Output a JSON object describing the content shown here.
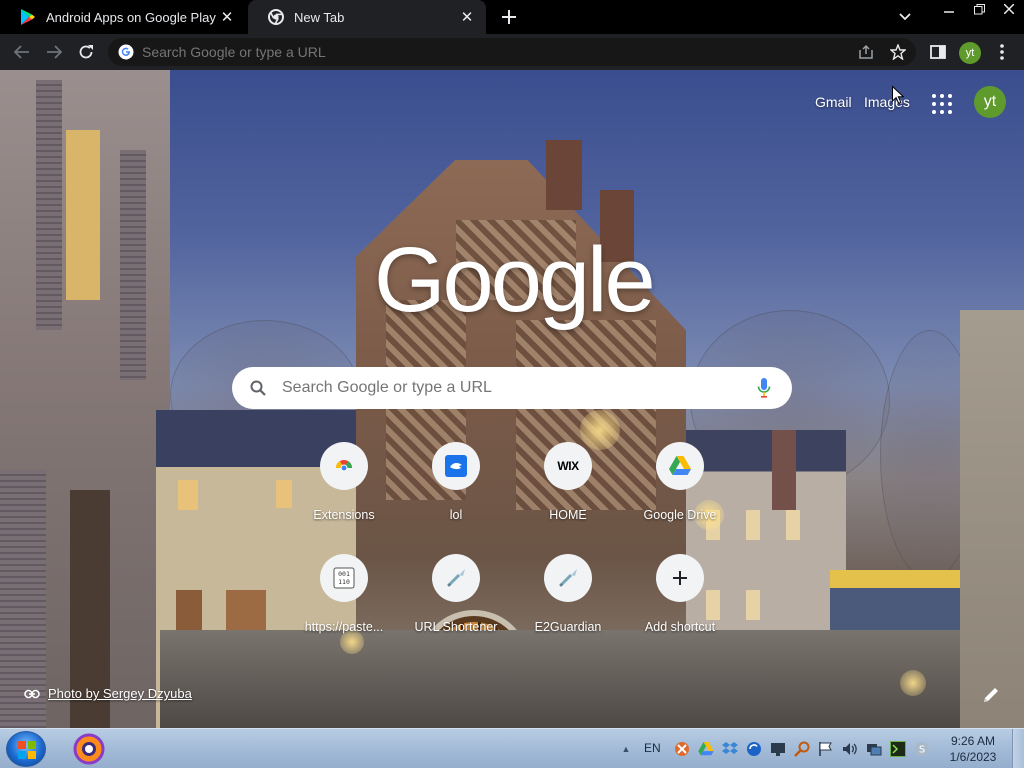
{
  "browser": {
    "tabs": [
      {
        "title": "Android Apps on Google Play",
        "favicon": "google-play-icon",
        "active": false
      },
      {
        "title": "New Tab",
        "favicon": "chrome-icon",
        "active": true
      }
    ],
    "omnibox": {
      "placeholder": "Search Google or type a URL"
    },
    "profile_initials": "yt"
  },
  "ntp": {
    "top_links": {
      "gmail": "Gmail",
      "images": "Images"
    },
    "logo_text": "Google",
    "search_placeholder": "Search Google or type a URL",
    "avatar_initials": "yt",
    "shortcuts": [
      {
        "label": "Extensions",
        "icon": "extensions-icon"
      },
      {
        "label": "lol",
        "icon": "lol-icon"
      },
      {
        "label": "HOME",
        "icon": "wix-icon",
        "icon_text": "WIX"
      },
      {
        "label": "Google Drive",
        "icon": "google-drive-icon"
      },
      {
        "label": "https://paste...",
        "icon": "paste-icon"
      },
      {
        "label": "URL Shortener",
        "icon": "url-shortener-icon"
      },
      {
        "label": "E2Guardian",
        "icon": "e2guardian-icon"
      },
      {
        "label": "Add shortcut",
        "icon": "plus-icon"
      }
    ],
    "attribution": "Photo by Sergey Dzyuba"
  },
  "taskbar": {
    "language": "EN",
    "time": "9:26 AM",
    "date": "1/6/2023"
  },
  "colors": {
    "tabstrip": "#000000",
    "toolbar": "#202124",
    "omnibox": "#171717",
    "avatar": "#5e9b2c",
    "taskbar": "#a3bbd7"
  }
}
